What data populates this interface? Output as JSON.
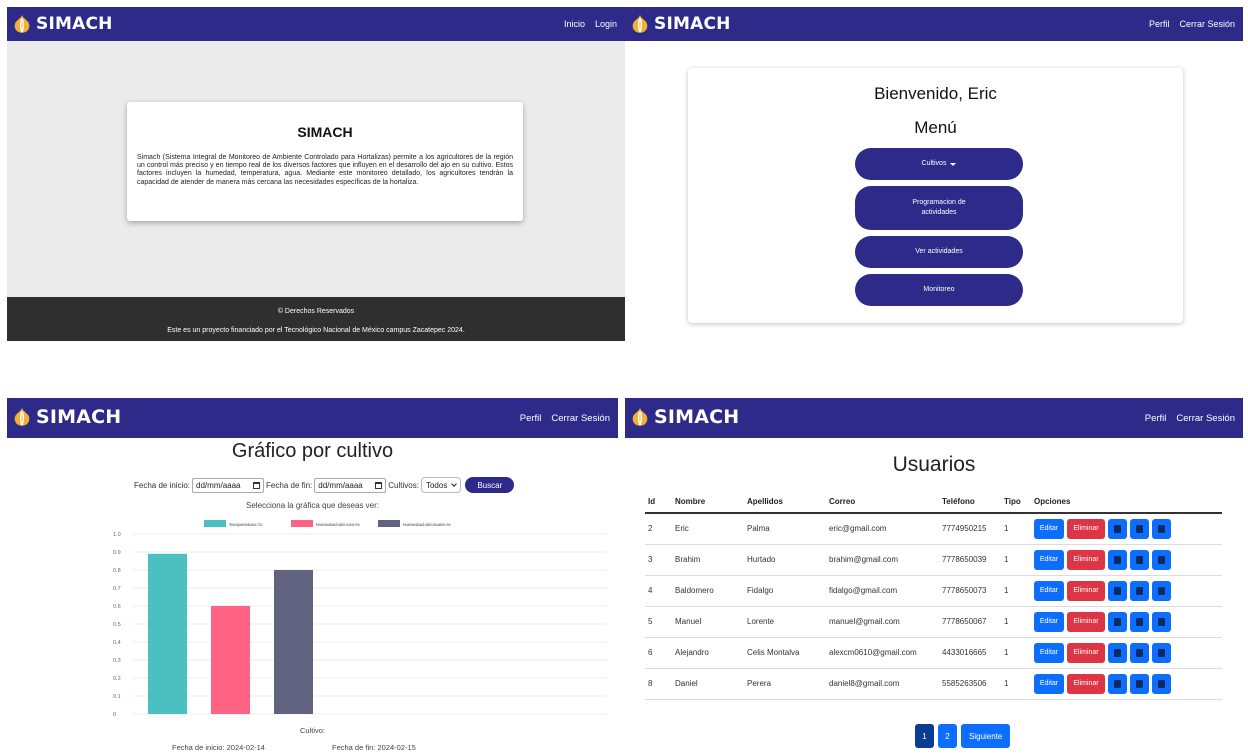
{
  "brand": "SIMACH",
  "panel1": {
    "nav": [
      "Inicio",
      "Login"
    ],
    "card_title": "SIMACH",
    "card_text": "Simach (Sistema Integral de Monitoreo de Ambiente Controlado para Hortalizas) permite a los agricultores de la región un control más preciso y en tiempo real de los diversos factores que influyen en el desarrollo del ajo en su cultivo. Estos factores incluyen la humedad, temperatura, agua. Mediante este monitoreo detallado, los agricultores tendrán la capacidad de atender de manera más cercana las necesidades específicas de la hortaliza.",
    "footer_line1": "© Derechos Reservados",
    "footer_line2": "Este es un proyecto financiado por el Tecnológico Nacional de México campus Zacatepec 2024."
  },
  "panel2": {
    "nav": [
      "Perfil",
      "Cerrar Sesión"
    ],
    "welcome": "Bienvenido, Eric",
    "menu_title": "Menú",
    "buttons": [
      "Cultivos",
      "Programacion de actividades",
      "Ver actividades",
      "Monitoreo"
    ]
  },
  "panel3": {
    "nav": [
      "Perfil",
      "Cerrar Sesión"
    ],
    "title": "Gráfico por cultivo",
    "filters": {
      "start_label": "Fecha de inicio:",
      "start_placeholder": "dd/mm/aaaa",
      "end_label": "Fecha de fin:",
      "end_placeholder": "dd/mm/aaaa",
      "crop_label": "Cultivos:",
      "crop_value": "Todos",
      "search_button": "Buscar"
    },
    "select_hint": "Selecciona la gráfica que deseas ver:",
    "xlabel": "Cultivo:",
    "start_date_caption": "Fecha de inicio: 2024-02-14",
    "end_date_caption": "Fecha de fin: 2024-02-15"
  },
  "chart_data": {
    "type": "bar",
    "series": [
      {
        "name": "Temperatura °C",
        "color": "#4bc0c0",
        "values": [
          0.89
        ]
      },
      {
        "name": "Humedad del Aire %",
        "color": "#ff6384",
        "values": [
          0.6
        ]
      },
      {
        "name": "Humedad del Suelo %",
        "color": "#616180",
        "values": [
          0.8
        ]
      }
    ],
    "yticks": [
      "0",
      "0.1",
      "0.2",
      "0.3",
      "0.4",
      "0.5",
      "0.6",
      "0.7",
      "0.8",
      "0.9",
      "1.0"
    ],
    "ylim": [
      0,
      1.0
    ],
    "legend_position": "top",
    "grid": true
  },
  "panel4": {
    "nav": [
      "Perfil",
      "Cerrar Sesión"
    ],
    "title": "Usuarios",
    "columns": [
      "Id",
      "Nombre",
      "Apellidos",
      "Correo",
      "Teléfono",
      "Tipo",
      "Opciones"
    ],
    "rows": [
      [
        "2",
        "Eric",
        "Palma",
        "eric@gmail.com",
        "7774950215",
        "1"
      ],
      [
        "3",
        "Brahim",
        "Hurtado",
        "brahim@gmail.com",
        "7778650039",
        "1"
      ],
      [
        "4",
        "Baldomero",
        "Fidalgo",
        "fidalgo@gmail.com",
        "7778650073",
        "1"
      ],
      [
        "5",
        "Manuel",
        "Lorente",
        "manuel@gmail.com",
        "7778650067",
        "1"
      ],
      [
        "6",
        "Alejandro",
        "Celis Montalva",
        "alexcm0610@gmail.com",
        "4433016665",
        "1"
      ],
      [
        "8",
        "Daniel",
        "Perera",
        "daniel8@gmail.com",
        "5585263506",
        "1"
      ]
    ],
    "edit_label": "Editar",
    "delete_label": "Eliminar",
    "row_icons": [
      "trash-icon",
      "image-icon",
      "grid-icon"
    ],
    "pager": [
      "1",
      "2",
      "Siguiente"
    ]
  }
}
